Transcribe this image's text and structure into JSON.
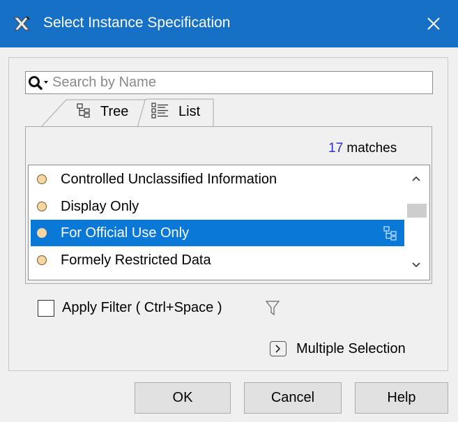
{
  "window": {
    "title": "Select Instance Specification",
    "icon": "magicdraw-app-icon",
    "close_icon": "close-icon"
  },
  "search": {
    "placeholder": "Search by Name",
    "value": ""
  },
  "tabs": [
    {
      "label": "Tree",
      "icon": "tree-icon",
      "active": false
    },
    {
      "label": "List",
      "icon": "list-icon",
      "active": true
    }
  ],
  "matches": {
    "count": "17",
    "label": "matches"
  },
  "list": {
    "items": [
      {
        "label": "Controlled Unclassified Information",
        "selected": false
      },
      {
        "label": "Display Only",
        "selected": false
      },
      {
        "label": "For Official Use Only",
        "selected": true
      },
      {
        "label": "Formely Restricted Data",
        "selected": false
      }
    ]
  },
  "filter": {
    "label": "Apply Filter ( Ctrl+Space )",
    "checked": false,
    "icon": "filter-icon"
  },
  "multiple_selection": {
    "label": "Multiple Selection",
    "icon": "chevron-right-icon"
  },
  "buttons": {
    "ok": "OK",
    "cancel": "Cancel",
    "help": "Help"
  },
  "colors": {
    "titlebar": "#1670c6",
    "selection": "#0a78d7",
    "match_count": "#2d2dd0"
  }
}
